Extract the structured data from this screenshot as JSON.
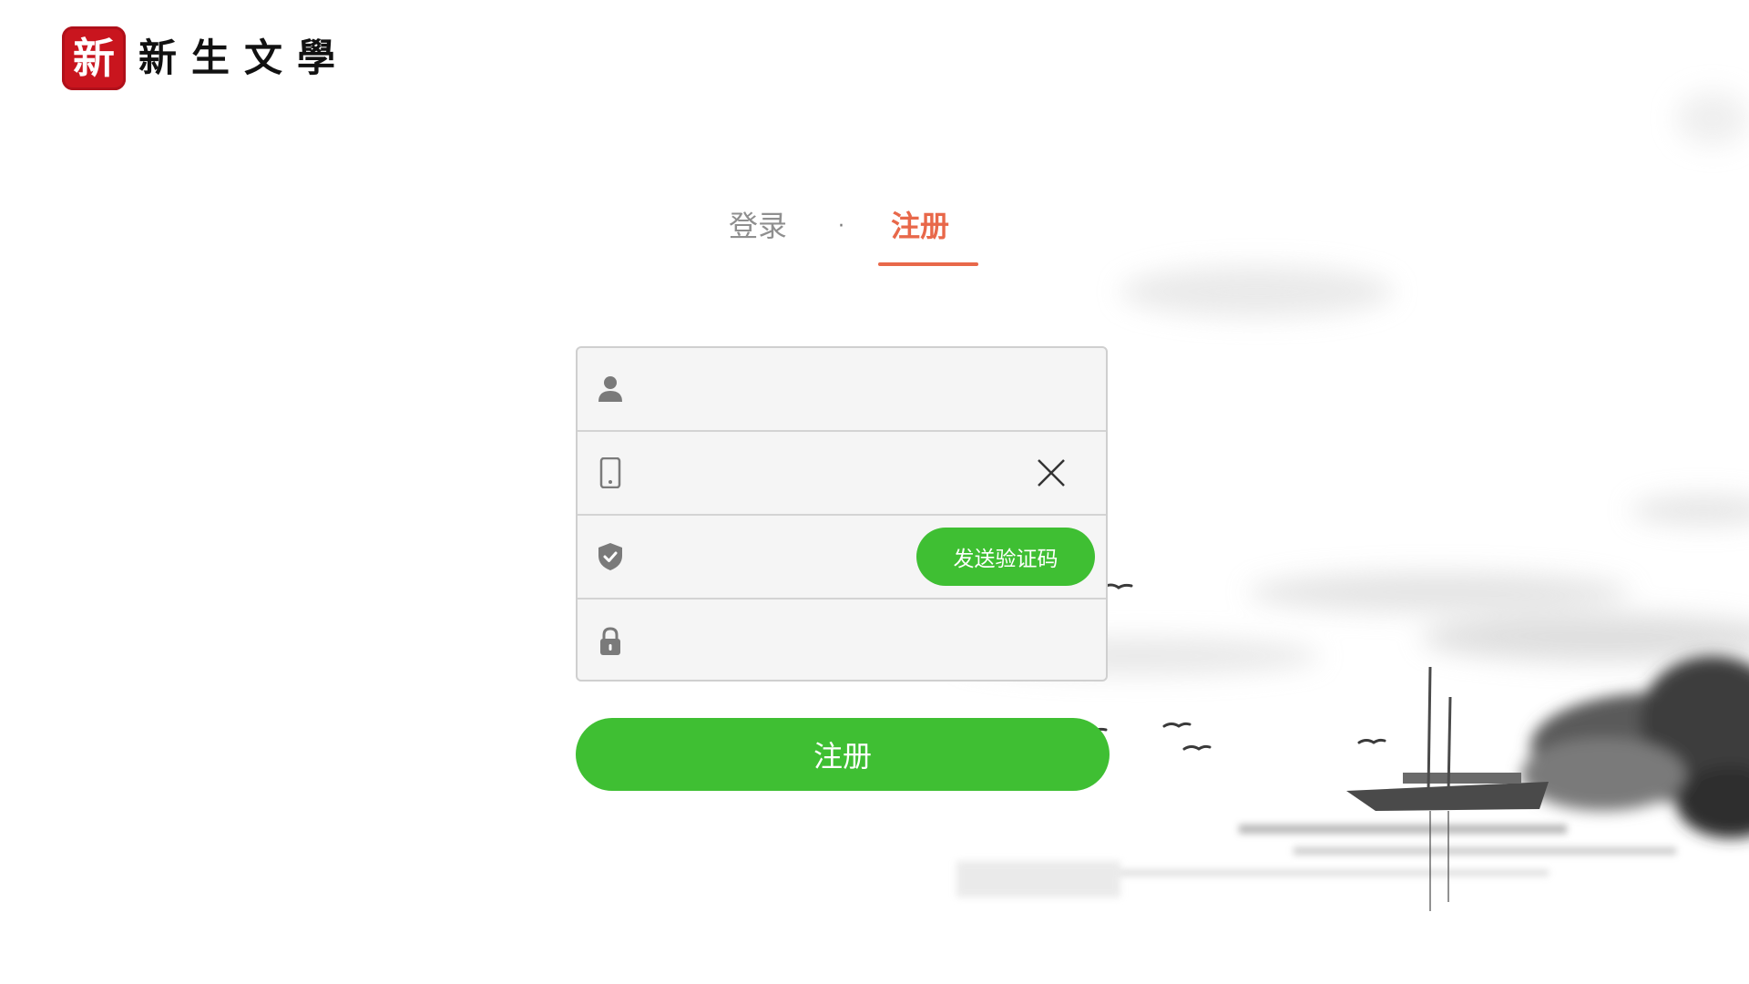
{
  "brand": {
    "seal_char": "新",
    "name": "新生文學",
    "seal_color": "#c9151e"
  },
  "tabs": {
    "login_label": "登录",
    "separator": "·",
    "register_label": "注册",
    "active": "register",
    "active_color": "#e8684a"
  },
  "form": {
    "fields": [
      {
        "icon": "user-icon",
        "value": ""
      },
      {
        "icon": "phone-icon",
        "value": "",
        "clear_icon": "close-icon"
      },
      {
        "icon": "shield-icon",
        "value": "",
        "action_label": "发送验证码"
      },
      {
        "icon": "lock-icon",
        "value": ""
      }
    ],
    "submit_label": "注册",
    "button_color": "#3fbf33"
  }
}
